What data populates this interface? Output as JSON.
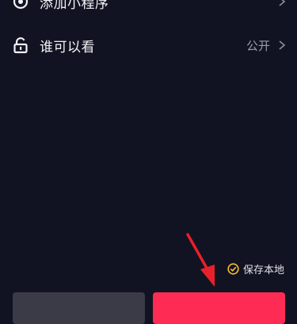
{
  "rows": {
    "miniprogram": {
      "label": "添加小程序",
      "icon": "mini-program-icon"
    },
    "visibility": {
      "label": "谁可以看",
      "value": "公开",
      "icon": "unlock-icon"
    }
  },
  "save_local": {
    "label": "保存本地",
    "icon": "check-circle-icon",
    "color": "#f6c02d"
  },
  "colors": {
    "background": "#121322",
    "publish": "#fe2c55",
    "draft": "#3a3b47",
    "arrow": "#e8202a"
  }
}
